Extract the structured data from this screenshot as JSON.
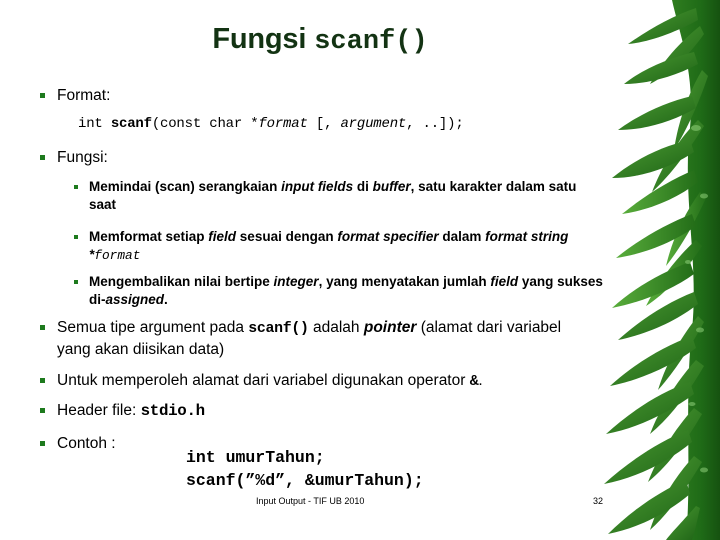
{
  "slide": {
    "title_word": "Fungsi",
    "title_code": "scanf()",
    "title_color": "#133313",
    "bullet_color": "#1d7a1d",
    "background_color": "#ffffff"
  },
  "bullets": {
    "format_label": "Format:",
    "format_signature_parts": {
      "p1": "int ",
      "p2": "scanf",
      "p3": "(const char *",
      "p4": "format",
      "p5": " [, ",
      "p6": "argument",
      "p7": ", ..]);"
    },
    "fungsi_label": "Fungsi:",
    "sub_items": [
      {
        "p1": "Memindai (scan) serangkaian ",
        "p2": "input fields",
        "p3": " di ",
        "p4": "buffer",
        "p5": ", satu karakter dalam satu saat"
      },
      {
        "p1": "Memformat setiap ",
        "p2": "field",
        "p3": " sesuai dengan ",
        "p4": "format specifier",
        "p5": " dalam ",
        "p6": "format string",
        "p7": " *",
        "p8": "format"
      },
      {
        "p1": "Mengembalikan nilai bertipe ",
        "p2": "integer",
        "p3": ", yang menyatakan jumlah ",
        "p4": "field",
        "p5": " yang sukses di-",
        "p6": "assigned",
        "p7": "."
      }
    ],
    "pointer_item": {
      "p1": "Semua tipe argument pada ",
      "p2": "scanf()",
      "p3": " adalah ",
      "p4": "pointer",
      "p5": " (alamat dari variabel yang akan diisikan data)"
    },
    "operator_item": {
      "p1": "Untuk memperoleh alamat dari variabel digunakan operator ",
      "p2": "&",
      "p3": "."
    },
    "header_item": {
      "p1": "Header file: ",
      "p2": "stdio.h"
    },
    "contoh_label": "Contoh :"
  },
  "example_code": {
    "line1": "int umurTahun;",
    "line2": "scanf(”%d”, &umurTahun);"
  },
  "footer": {
    "text": "Input Output - TIF UB 2010",
    "page_number": "32"
  }
}
